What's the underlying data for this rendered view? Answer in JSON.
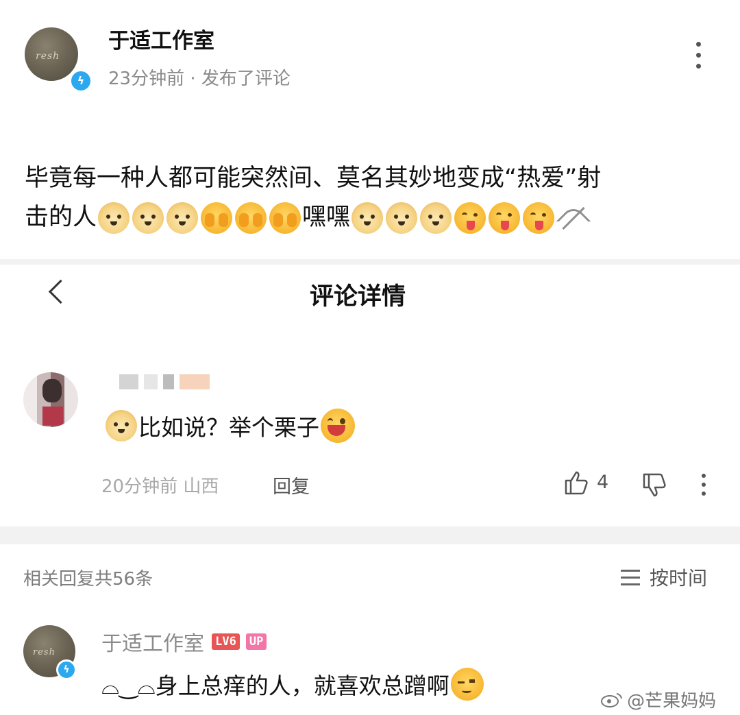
{
  "post": {
    "author": "于适工作室",
    "meta": "23分钟前 · 发布了评论",
    "text_line1": "毕竟每一种人都可能突然间、莫名其妙地变成“热爱”射",
    "text_line2_prefix": "击的人",
    "text_middle": "嘿嘿",
    "emoji_sequence": [
      "dog-crown",
      "dog-crown",
      "dog-crown",
      "hide-face",
      "hide-face",
      "hide-face",
      "dog",
      "dog",
      "dog",
      "tongue-face",
      "tongue-face",
      "tongue-face",
      "bow-arrow"
    ]
  },
  "detail": {
    "back_icon": "chevron-left-icon",
    "title": "评论详情"
  },
  "main_comment": {
    "text": "比如说？举个栗子",
    "time_location": "20分钟前 山西",
    "reply_label": "回复",
    "like_count": "4"
  },
  "replies": {
    "count_label": "相关回复共56条",
    "sort_label": "按时间"
  },
  "sub_comment": {
    "author": "于适工作室",
    "level_badge": "LV6",
    "up_badge": "UP",
    "text": "⌓‿⌓身上总痒的人，就喜欢总蹭啊"
  },
  "watermark": "@芒果妈妈",
  "colors": {
    "verify_blue": "#2aa8f0",
    "lv_red": "#e85555",
    "up_pink": "#f277a8"
  }
}
